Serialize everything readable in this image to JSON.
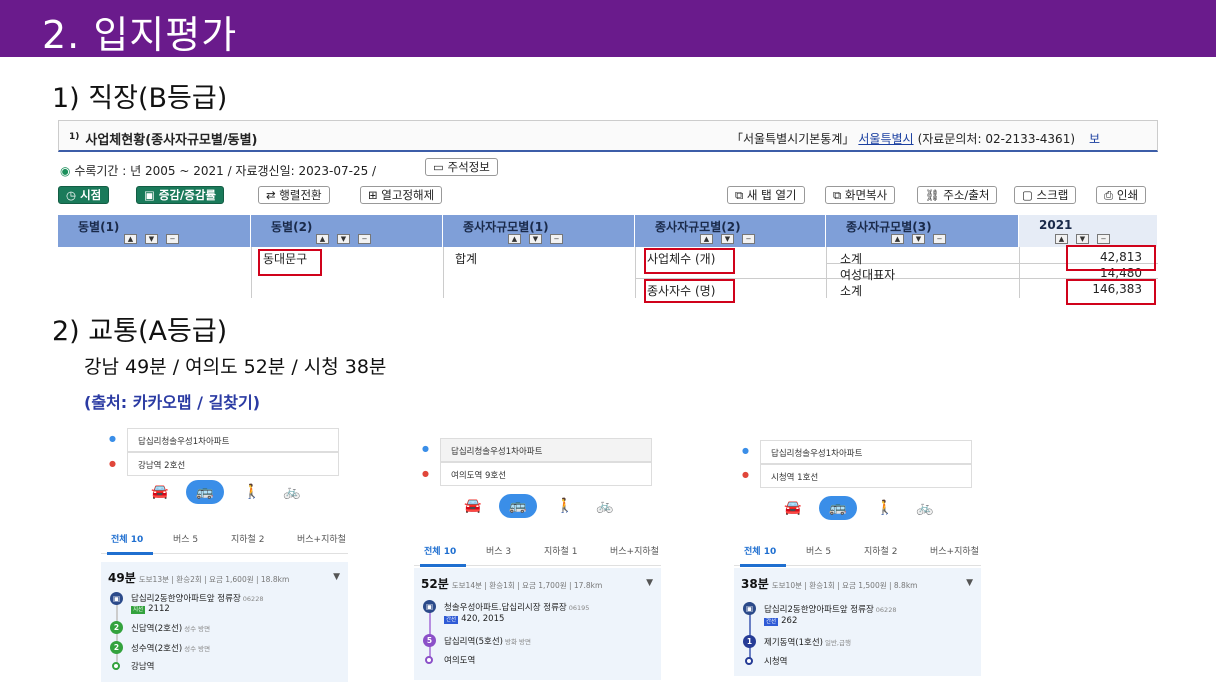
{
  "header": {
    "title": "2. 입지평가"
  },
  "sec1": {
    "title": "1) 직장(B등급)"
  },
  "sec2": {
    "title": "2) 교통(A등급)"
  },
  "commute": "강남 49분 / 여의도 52분 / 시청 38분",
  "source_note": "(출처: 카카오맵 / 길찾기)",
  "stats": {
    "num": "1)",
    "title": "사업체현황(종사자규모별/동별)",
    "source_label": "「서울특별시기본통계」",
    "source_link": "서울특별시",
    "contact": "(자료문의처: 02-2133-4361)",
    "cut": "보",
    "period": "수록기간 : 년 2005 ~ 2021 / 자료갱신일: 2023-07-25 /",
    "note_btn": "주석정보",
    "buttons": {
      "timepoint": "시점",
      "change": "증감/증감률",
      "swap": "행렬전환",
      "unfix": "열고정해제",
      "newtab": "새 탭 열기",
      "capture": "화면복사",
      "addr": "주소/출처",
      "scrap": "스크랩",
      "print": "인쇄"
    },
    "columns": [
      "동별(1)",
      "동별(2)",
      "종사자규모별(1)",
      "종사자규모별(2)",
      "종사자규모별(3)",
      "2021"
    ],
    "cells": {
      "dong": "동대문구",
      "total": "합계",
      "biz": "사업체수 (개)",
      "emp": "종사자수 (명)",
      "sub": "소계",
      "female": "여성대표자",
      "sub2": "소계"
    },
    "values": [
      "42,813",
      "14,480",
      "146,383"
    ]
  },
  "map_gangnam": {
    "from": "답십리청솔우성1차아파트",
    "to": "강남역 2호선",
    "tabs": [
      "전체 10",
      "버스 5",
      "지하철 2",
      "버스+지하철"
    ],
    "time": "49분",
    "detail": "도보13분 | 환승2회 | 요금 1,600원 | 18.8km",
    "steps": [
      {
        "icon": "",
        "name": "답십리2동한양아파트앞 정류장",
        "sub": "06228",
        "tag": "지선",
        "extra": "2112"
      },
      {
        "icon": "2",
        "name": "신답역(2호선)",
        "sub": "성수 방면"
      },
      {
        "icon": "2",
        "name": "성수역(2호선)",
        "sub": "성수 방면"
      },
      {
        "icon": "",
        "name": "강남역",
        "sub": ""
      }
    ]
  },
  "map_yeouido": {
    "from": "답십리청솔우성1차아파트",
    "to": "여의도역 9호선",
    "tabs": [
      "전체 10",
      "버스 3",
      "지하철 1",
      "버스+지하철"
    ],
    "time": "52분",
    "detail": "도보14분 | 환승1회 | 요금 1,700원 | 17.8km",
    "steps": [
      {
        "icon": "",
        "name": "청솔우성아파트.답십리시장 정류장",
        "sub": "06195",
        "tag": "간선",
        "tag2": "지선",
        "extra": "420, 2015"
      },
      {
        "icon": "5",
        "name": "답십리역(5호선)",
        "sub": "방화 방면"
      },
      {
        "icon": "",
        "name": "여의도역",
        "sub": ""
      }
    ]
  },
  "map_cityhall": {
    "from": "답십리청솔우성1차아파트",
    "to": "시청역 1호선",
    "tabs": [
      "전체 10",
      "버스 5",
      "지하철 2",
      "버스+지하철"
    ],
    "time": "38분",
    "detail": "도보10분 | 환승1회 | 요금 1,500원 | 8.8km",
    "steps": [
      {
        "icon": "",
        "name": "답십리2동한양아파트앞 정류장",
        "sub": "06228",
        "tag": "간선",
        "extra": "262"
      },
      {
        "icon": "1",
        "name": "제기동역(1호선)",
        "sub": "일반,급행"
      },
      {
        "icon": "",
        "name": "시청역",
        "sub": ""
      }
    ]
  }
}
